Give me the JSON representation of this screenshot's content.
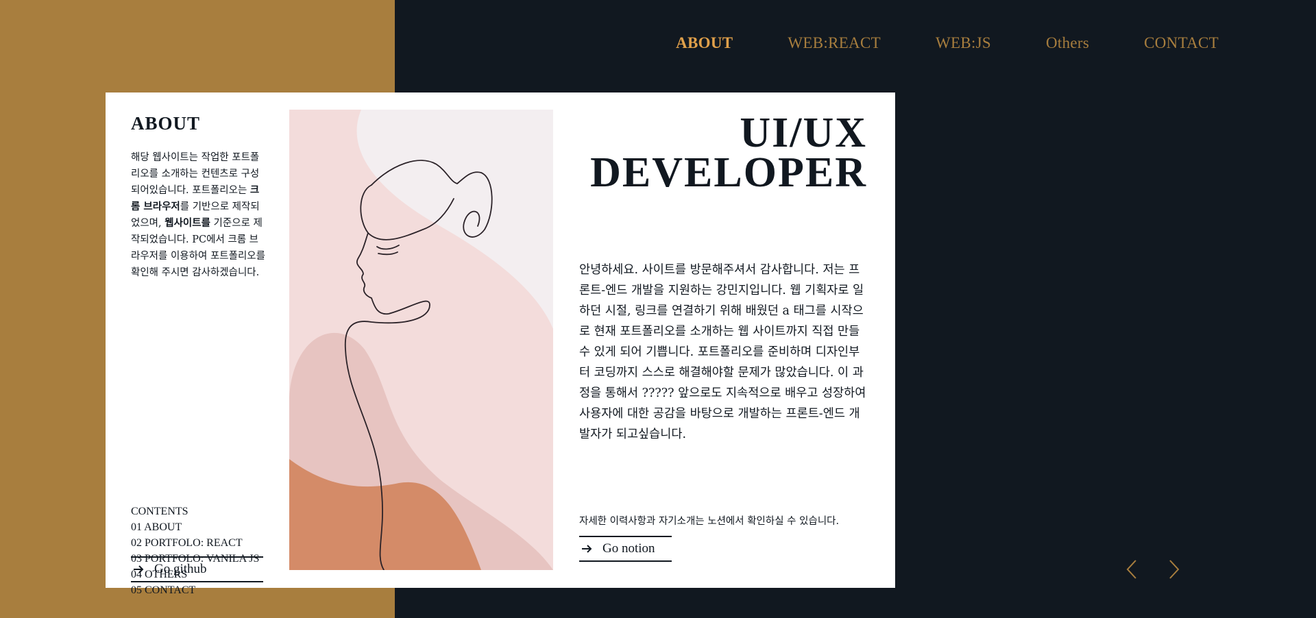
{
  "nav": {
    "items": [
      {
        "label": "ABOUT",
        "active": true
      },
      {
        "label": "WEB:REACT",
        "active": false
      },
      {
        "label": "WEB:JS",
        "active": false
      },
      {
        "label": "Others",
        "active": false
      },
      {
        "label": "CONTACT",
        "active": false
      }
    ]
  },
  "about": {
    "title": "ABOUT",
    "intro_1": "해당 웹사이트는 작업한 포트폴리오를 소개하는 컨텐츠로 구성되어있습니다. 포트폴리오는 ",
    "intro_bold_1": "크롬 브라우저",
    "intro_2": "를 기반으로 제작되었으며, ",
    "intro_bold_2": "웹사이트를",
    "intro_3": " 기준으로 제작되었습니다. PC에서 크롬 브라우저를 이용하여 포트폴리오를 확인해 주시면 감사하겠습니다."
  },
  "contents": {
    "heading": "CONTENTS",
    "items": [
      "01 ABOUT",
      "02 PORTFOLO: REACT",
      "03 PORTFOLO: VANILA JS",
      "04 OTHERS",
      "05 CONTACT"
    ]
  },
  "github_button": {
    "label": "Go github",
    "icon": "arrow-right-icon"
  },
  "headline": {
    "line1": "UI/UX",
    "line2": "DEVELOPER"
  },
  "body_text": "안녕하세요. 사이트를 방문해주셔서 감사합니다. 저는 프론트-엔드 개발을 지원하는 강민지입니다. 웹 기획자로 일하던 시절, 링크를 연결하기 위해 배웠던 a 태그를 시작으로 현재 포트폴리오를 소개하는 웹 사이트까지 직접 만들 수 있게 되어 기쁩니다. 포트폴리오를 준비하며 디자인부터 코딩까지 스스로 해결해야할 문제가 많았습니다. 이 과정을 통해서 ????? 앞으로도 지속적으로 배우고 성장하여 사용자에 대한 공감을 바탕으로 개발하는 프론트-엔드 개발자가 되고싶습니다.",
  "note": "자세한 이력사항과 자기소개는 노션에서 확인하실 수 있습니다.",
  "notion_button": {
    "label": "Go notion",
    "icon": "arrow-right-icon"
  },
  "slider": {
    "prev_icon": "chevron-left-icon",
    "next_icon": "chevron-right-icon"
  },
  "colors": {
    "gold": "#a87e3e",
    "navy": "#111820",
    "accent": "#e0a04a",
    "peach": "#d48b68",
    "blush": "#f3dcdb"
  }
}
